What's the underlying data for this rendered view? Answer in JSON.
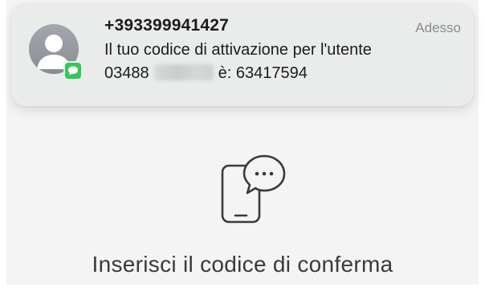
{
  "notification": {
    "sender": "+393399941427",
    "time": "Adesso",
    "line1": "Il tuo codice di attivazione per l'utente",
    "line2_prefix": "03488",
    "line2_suffix": "è: 63417594",
    "avatar_icon": "person-icon",
    "app_icon": "messages-icon",
    "accent_color": "#34c759"
  },
  "main": {
    "icon": "phone-chat-icon",
    "title": "Inserisci il codice di conferma"
  }
}
